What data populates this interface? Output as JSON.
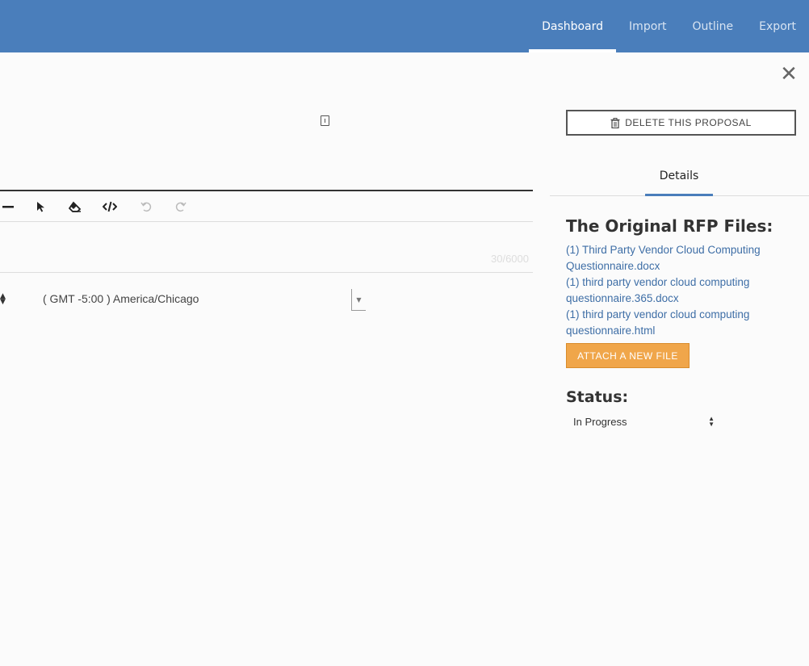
{
  "header": {
    "nav": [
      {
        "label": "Dashboard",
        "active": true
      },
      {
        "label": "Import",
        "active": false
      },
      {
        "label": "Outline",
        "active": false
      },
      {
        "label": "Export",
        "active": false
      }
    ]
  },
  "editor": {
    "toolbar": {
      "buttons": [
        "horizontal-rule",
        "select",
        "eraser",
        "code-view",
        "undo",
        "redo"
      ]
    },
    "char_count": "30/6000",
    "timezone": "( GMT -5:00 ) America/Chicago"
  },
  "panel": {
    "close_glyph": "✕",
    "delete_label": "DELETE THIS PROPOSAL",
    "tab_details": "Details",
    "rfp_title": "The Original RFP Files:",
    "files": [
      "(1) Third Party Vendor Cloud Computing Questionnaire.docx",
      "(1) third party vendor cloud computing questionnaire.365.docx",
      "(1) third party vendor cloud computing questionnaire.html"
    ],
    "attach_label": "ATTACH A NEW FILE",
    "status_label": "Status:",
    "status_value": "In Progress"
  },
  "colors": {
    "header_bg": "#4a7ebb",
    "link": "#3e6ea6",
    "attach_bg": "#f0a64a"
  }
}
